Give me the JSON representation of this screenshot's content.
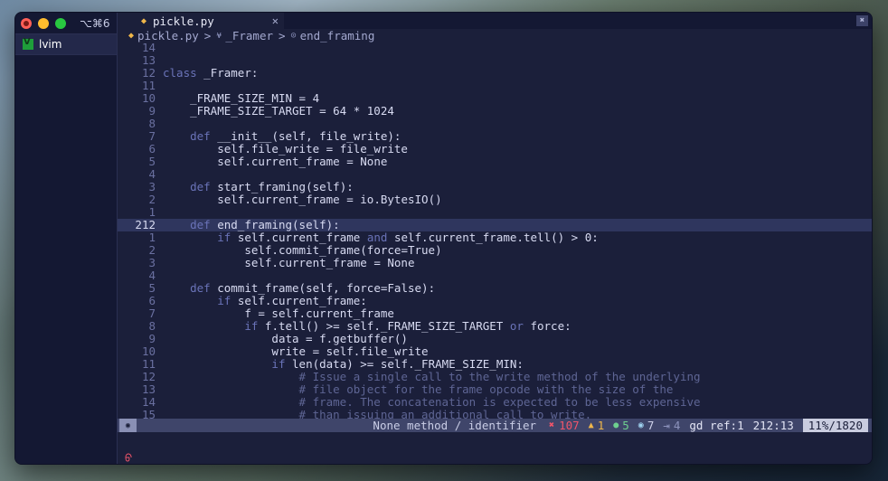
{
  "sidebar": {
    "shortcut": "⌥⌘6",
    "session_label": "lvim"
  },
  "editor": {
    "tab_title": "pickle.py",
    "tab_close": "✕",
    "window_close": "✖",
    "breadcrumb": {
      "file": "pickle.py",
      "sep": ">",
      "class_name": "_Framer",
      "method_name": "end_framing"
    }
  },
  "code_lines": [
    {
      "num": "14",
      "text": ""
    },
    {
      "num": "13",
      "text": ""
    },
    {
      "num": "12",
      "text": "class _Framer:"
    },
    {
      "num": "11",
      "text": ""
    },
    {
      "num": "10",
      "text": "    _FRAME_SIZE_MIN = 4"
    },
    {
      "num": "9",
      "text": "    _FRAME_SIZE_TARGET = 64 * 1024"
    },
    {
      "num": "8",
      "text": ""
    },
    {
      "num": "7",
      "text": "    def __init__(self, file_write):"
    },
    {
      "num": "6",
      "text": "        self.file_write = file_write"
    },
    {
      "num": "5",
      "text": "        self.current_frame = None"
    },
    {
      "num": "4",
      "text": ""
    },
    {
      "num": "3",
      "text": "    def start_framing(self):"
    },
    {
      "num": "2",
      "text": "        self.current_frame = io.BytesIO()"
    },
    {
      "num": "1",
      "text": ""
    },
    {
      "num": "212",
      "text": "    def end_framing(self):",
      "current": true
    },
    {
      "num": "1",
      "text": "        if self.current_frame and self.current_frame.tell() > 0:"
    },
    {
      "num": "2",
      "text": "            self.commit_frame(force=True)"
    },
    {
      "num": "3",
      "text": "            self.current_frame = None"
    },
    {
      "num": "4",
      "text": ""
    },
    {
      "num": "5",
      "text": "    def commit_frame(self, force=False):"
    },
    {
      "num": "6",
      "text": "        if self.current_frame:"
    },
    {
      "num": "7",
      "text": "            f = self.current_frame"
    },
    {
      "num": "8",
      "text": "            if f.tell() >= self._FRAME_SIZE_TARGET or force:"
    },
    {
      "num": "9",
      "text": "                data = f.getbuffer()"
    },
    {
      "num": "10",
      "text": "                write = self.file_write"
    },
    {
      "num": "11",
      "text": "                if len(data) >= self._FRAME_SIZE_MIN:"
    },
    {
      "num": "12",
      "text": "                    # Issue a single call to the write method of the underlying"
    },
    {
      "num": "13",
      "text": "                    # file object for the frame opcode with the size of the"
    },
    {
      "num": "14",
      "text": "                    # frame. The concatenation is expected to be less expensive"
    },
    {
      "num": "15",
      "text": "                    # than issuing an additional call to write."
    }
  ],
  "statusline": {
    "context": "None method / identifier",
    "errors": "107",
    "warnings": "1",
    "info": "5",
    "hints": "7",
    "tabsize": "4",
    "ref": "gd ref:1",
    "position": "212:13",
    "progress": "11%/1820"
  },
  "cmdline": "ᠪ"
}
